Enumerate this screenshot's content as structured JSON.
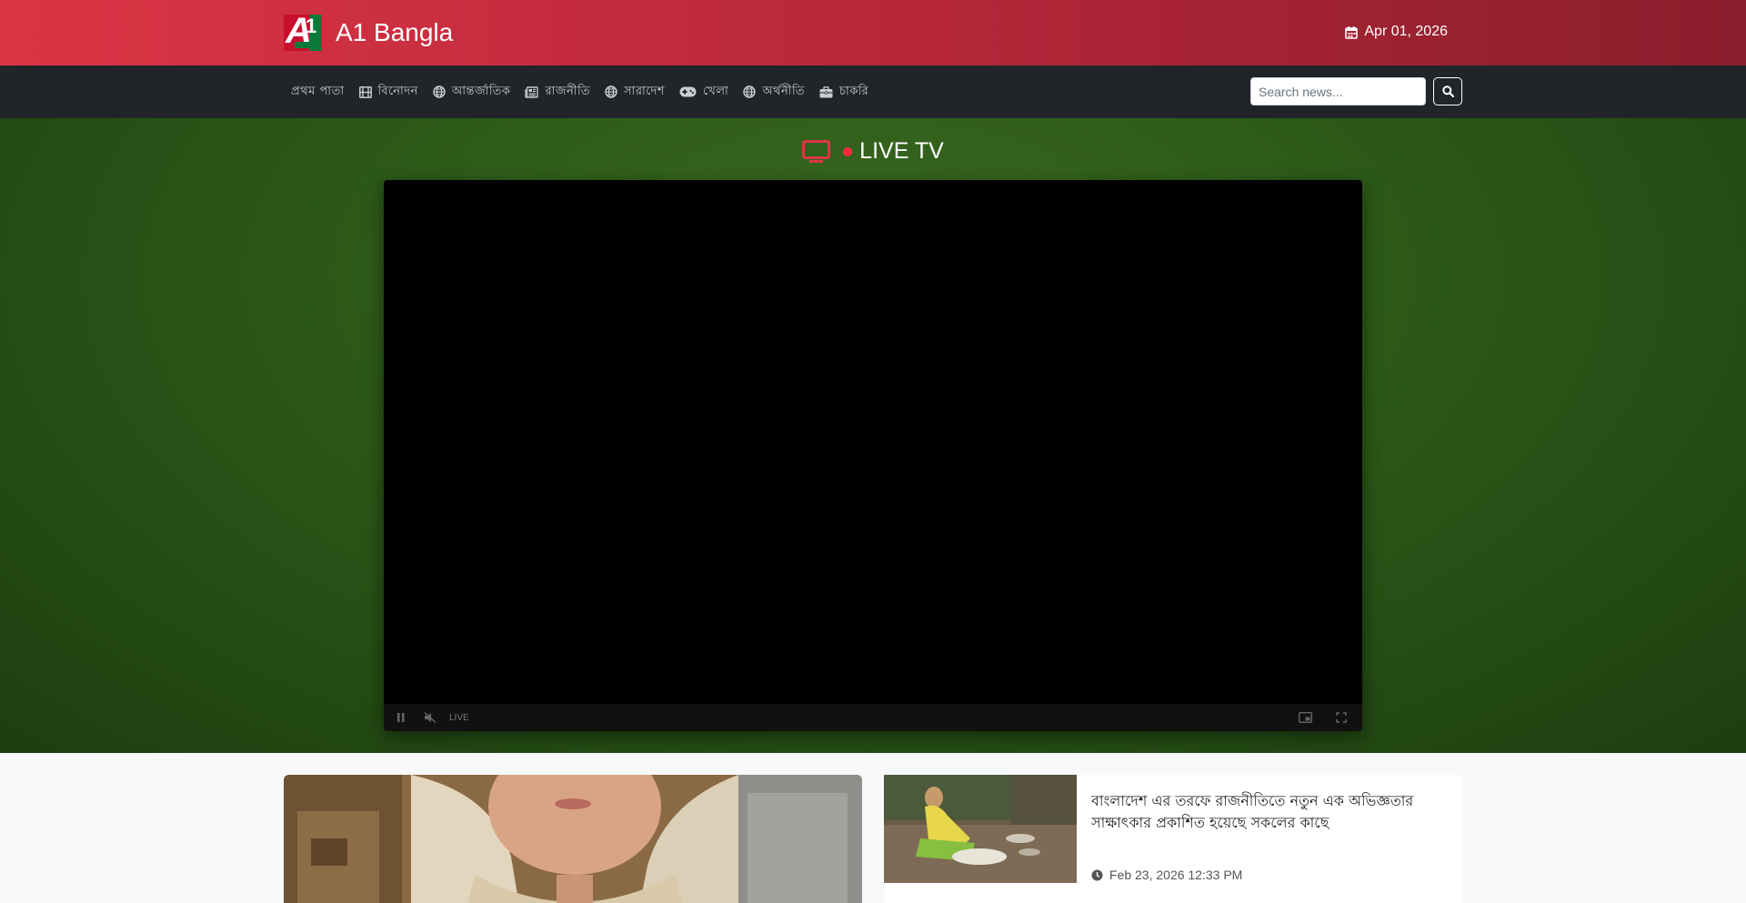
{
  "header": {
    "brand_name": "A1 Bangla",
    "logo_text": "A1",
    "date": "Apr 01, 2026"
  },
  "nav": {
    "items": [
      {
        "label": "প্রথম পাতা",
        "icon": "none"
      },
      {
        "label": "বিনোদন",
        "icon": "film-icon"
      },
      {
        "label": "আন্তর্জাতিক",
        "icon": "globe-icon"
      },
      {
        "label": "রাজনীতি",
        "icon": "newspaper-icon"
      },
      {
        "label": "সারাদেশ",
        "icon": "globe-icon"
      },
      {
        "label": "খেলা",
        "icon": "gamepad-icon"
      },
      {
        "label": "অর্থনীতি",
        "icon": "globe-icon"
      },
      {
        "label": "চাকরি",
        "icon": "briefcase-icon"
      }
    ]
  },
  "search": {
    "placeholder": "Search news..."
  },
  "live": {
    "label": "LIVE TV",
    "badge": "LIVE"
  },
  "news": {
    "side_title": "বাংলাদেশ এর তরফে রাজনীতিতে নতুন এক অভিজ্ঞতার সাক্ষাৎকার প্রকাশিত হয়েছে সকলের কাছে",
    "side_time": "Feb 23, 2026 12:33 PM"
  },
  "colors": {
    "header_red": "#dc3545",
    "nav_dark": "#212529",
    "live_green": "#2b5818",
    "live_dot": "#ff2d3a"
  }
}
